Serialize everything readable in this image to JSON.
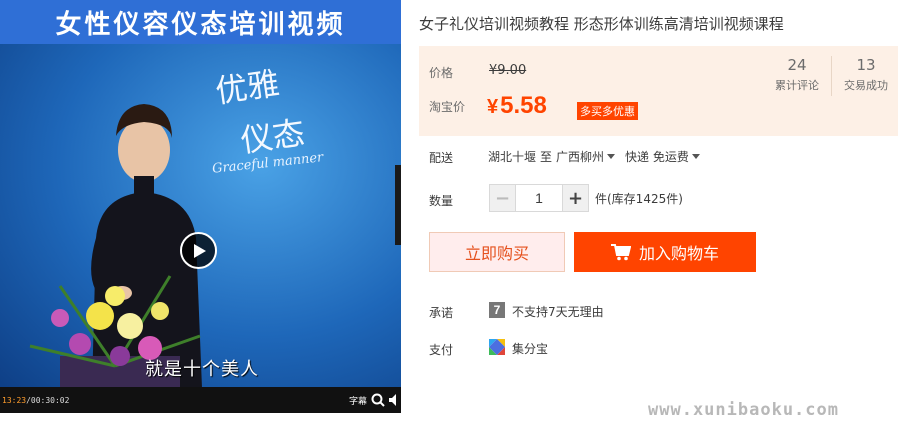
{
  "video": {
    "banner_title": "女性仪容仪态培训视频",
    "calligraphy": "优雅仪态",
    "script_text": "Graceful manner",
    "subtitle": "就是十个美人",
    "current_time": "13:23",
    "total_time": "/00:30:02",
    "subtitle_toggle": "字幕",
    "colors": {
      "banner": "#2f6fd6",
      "current_time": "#ff9d2c"
    }
  },
  "product": {
    "title": "女子礼仪培训视频教程 形态形体训练高清培训视频课程"
  },
  "price": {
    "original_label": "价格",
    "original_value": "¥9.00",
    "taobao_label": "淘宝价",
    "currency": "¥",
    "taobao_value": "5.58",
    "promo_badge": "多买多优惠",
    "accent_color": "#ff4400"
  },
  "stats": {
    "reviews_count": "24",
    "reviews_label": "累计评论",
    "deals_count": "13",
    "deals_label": "交易成功"
  },
  "delivery": {
    "label": "配送",
    "origin": "湖北十堰",
    "to": "至",
    "destination": "广西柳州",
    "method": "快递",
    "fee": "免运费"
  },
  "quantity": {
    "label": "数量",
    "minus": "−",
    "plus": "+",
    "value": "1",
    "stock": "件(库存1425件)"
  },
  "actions": {
    "buy_now": "立即购买",
    "add_to_cart": "加入购物车"
  },
  "promise": {
    "label": "承诺",
    "icon_text": "7",
    "text": "不支持7天无理由"
  },
  "payment": {
    "label": "支付",
    "text": "集分宝"
  },
  "watermark": "www.xunibaoku.com"
}
